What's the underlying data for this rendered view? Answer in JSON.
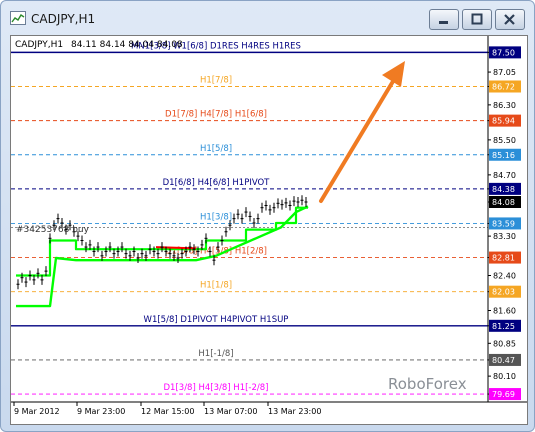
{
  "window": {
    "title": "CADJPY,H1",
    "buttons": [
      "minimize",
      "maximize",
      "close"
    ]
  },
  "chart_info": {
    "symbol_period": "CADJPY,H1",
    "ohlc": "84.11 84.14 84.04 84.08"
  },
  "watermark": "RoboForex",
  "order_label": "#34253768 buy",
  "colors": {
    "navy": "#000080",
    "red": "#e64a19",
    "orange": "#f5a623",
    "blue": "#2b8fd8",
    "green": "#00ff00",
    "magenta": "#ff00ff",
    "gray": "#555555",
    "arrow": "#f07b22"
  },
  "chart_data": {
    "type": "line",
    "x_ticks": [
      "9 Mar 2012",
      "9 Mar 23:00",
      "12 Mar 15:00",
      "13 Mar 07:00",
      "13 Mar 23:00"
    ],
    "y_ticks": [
      "87.50",
      "87.05",
      "86.72",
      "86.30",
      "85.94",
      "85.50",
      "85.16",
      "84.70",
      "84.38",
      "84.08",
      "83.59",
      "83.30",
      "82.81",
      "82.40",
      "82.03",
      "81.60",
      "81.25",
      "80.85",
      "80.47",
      "80.10",
      "79.69"
    ],
    "ylim": [
      79.6,
      87.6
    ],
    "levels": [
      {
        "price": 87.5,
        "label": "MN1[3/8] W1[6/8] D1RES H4RES H1RES",
        "color": "#000080",
        "style": "solid",
        "price_label": "87.50",
        "badge_bg": "#000080"
      },
      {
        "price": 86.72,
        "label": "H1[7/8]",
        "color": "#f5a623",
        "style": "dash",
        "price_label": "86.72",
        "badge_bg": "#f5a623"
      },
      {
        "price": 85.94,
        "label": "D1[7/8] H4[7/8] H1[6/8]",
        "color": "#e64a19",
        "style": "dash",
        "price_label": "85.94",
        "badge_bg": "#e64a19"
      },
      {
        "price": 85.16,
        "label": "H1[5/8]",
        "color": "#2b8fd8",
        "style": "dash",
        "price_label": "85.16",
        "badge_bg": "#2b8fd8"
      },
      {
        "price": 84.38,
        "label": "D1[6/8] H4[6/8] H1PIVOT",
        "color": "#000080",
        "style": "dash",
        "price_label": "84.38",
        "badge_bg": "#000080"
      },
      {
        "price": 83.59,
        "label": "H1[3/8]",
        "color": "#2b8fd8",
        "style": "dash",
        "price_label": "83.59",
        "badge_bg": "#2b8fd8"
      },
      {
        "price": 82.81,
        "label": "D1[5/8] H4[5/8] H1[2/8]",
        "color": "#e64a19",
        "style": "dash",
        "price_label": "82.81",
        "badge_bg": "#e64a19"
      },
      {
        "price": 82.03,
        "label": "H1[1/8]",
        "color": "#f5a623",
        "style": "dash",
        "price_label": "82.03",
        "badge_bg": "#f5a623"
      },
      {
        "price": 81.25,
        "label": "W1[5/8] D1PIVOT H4PIVOT H1SUP",
        "color": "#000080",
        "style": "solid",
        "price_label": "81.25",
        "badge_bg": "#000080"
      },
      {
        "price": 80.47,
        "label": "H1[-1/8]",
        "color": "#555555",
        "style": "dash",
        "price_label": "80.47",
        "badge_bg": "#555555"
      },
      {
        "price": 79.69,
        "label": "D1[3/8] H4[3/8] H1[-2/8]",
        "color": "#ff00ff",
        "style": "dash",
        "price_label": "79.69",
        "badge_bg": "#ff00ff"
      }
    ],
    "current_price": 84.08,
    "order_price": 83.5,
    "green_step_series": [
      [
        0,
        82.4
      ],
      [
        34,
        82.4
      ],
      [
        34,
        83.2
      ],
      [
        60,
        83.2
      ],
      [
        60,
        83.0
      ],
      [
        190,
        83.0
      ],
      [
        190,
        83.2
      ],
      [
        230,
        83.2
      ],
      [
        230,
        83.45
      ],
      [
        260,
        83.45
      ],
      [
        260,
        83.6
      ],
      [
        280,
        83.6
      ],
      [
        280,
        83.95
      ],
      [
        292,
        83.95
      ]
    ],
    "green_smooth_series": [
      [
        0,
        81.7
      ],
      [
        34,
        81.7
      ],
      [
        40,
        82.8
      ],
      [
        60,
        82.75
      ],
      [
        180,
        82.75
      ],
      [
        200,
        82.85
      ],
      [
        215,
        83.0
      ],
      [
        240,
        83.25
      ],
      [
        265,
        83.5
      ],
      [
        280,
        83.85
      ],
      [
        292,
        83.98
      ]
    ],
    "price_series": [
      [
        2,
        82.2
      ],
      [
        6,
        82.35
      ],
      [
        10,
        82.25
      ],
      [
        14,
        82.4
      ],
      [
        18,
        82.3
      ],
      [
        22,
        82.45
      ],
      [
        26,
        82.3
      ],
      [
        30,
        82.5
      ],
      [
        34,
        83.25
      ],
      [
        38,
        83.55
      ],
      [
        42,
        83.7
      ],
      [
        46,
        83.6
      ],
      [
        50,
        83.45
      ],
      [
        54,
        83.55
      ],
      [
        58,
        83.4
      ],
      [
        62,
        83.3
      ],
      [
        66,
        83.2
      ],
      [
        70,
        83.05
      ],
      [
        74,
        83.1
      ],
      [
        78,
        82.95
      ],
      [
        82,
        83.05
      ],
      [
        86,
        82.85
      ],
      [
        90,
        82.95
      ],
      [
        94,
        83.05
      ],
      [
        98,
        82.9
      ],
      [
        102,
        82.95
      ],
      [
        106,
        83.05
      ],
      [
        110,
        82.9
      ],
      [
        114,
        82.85
      ],
      [
        118,
        82.95
      ],
      [
        122,
        82.8
      ],
      [
        126,
        82.9
      ],
      [
        130,
        82.85
      ],
      [
        134,
        83.0
      ],
      [
        138,
        82.95
      ],
      [
        142,
        82.9
      ],
      [
        146,
        83.05
      ],
      [
        150,
        82.95
      ],
      [
        154,
        82.9
      ],
      [
        158,
        82.85
      ],
      [
        162,
        82.8
      ],
      [
        166,
        82.9
      ],
      [
        170,
        82.95
      ],
      [
        174,
        83.05
      ],
      [
        178,
        83.0
      ],
      [
        182,
        82.95
      ],
      [
        186,
        83.1
      ],
      [
        190,
        83.25
      ],
      [
        194,
        82.95
      ],
      [
        198,
        82.75
      ],
      [
        202,
        83.05
      ],
      [
        206,
        83.2
      ],
      [
        210,
        83.4
      ],
      [
        214,
        83.55
      ],
      [
        218,
        83.7
      ],
      [
        222,
        83.8
      ],
      [
        226,
        83.7
      ],
      [
        230,
        83.85
      ],
      [
        234,
        83.75
      ],
      [
        238,
        83.6
      ],
      [
        242,
        83.7
      ],
      [
        246,
        83.95
      ],
      [
        250,
        84.0
      ],
      [
        254,
        83.9
      ],
      [
        258,
        83.95
      ],
      [
        262,
        84.05
      ],
      [
        266,
        84.02
      ],
      [
        270,
        84.06
      ],
      [
        274,
        84.0
      ],
      [
        278,
        84.1
      ],
      [
        282,
        84.08
      ],
      [
        286,
        84.12
      ],
      [
        290,
        84.08
      ]
    ],
    "red_segment": [
      [
        140,
        83.05
      ],
      [
        180,
        83.02
      ]
    ]
  }
}
